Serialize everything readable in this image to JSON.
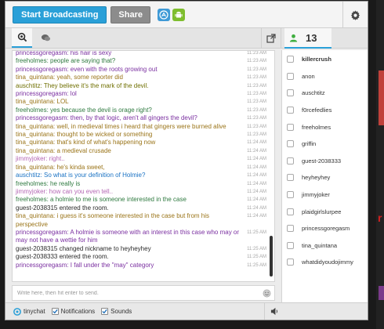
{
  "toolbar": {
    "broadcast_label": "Start Broadcasting",
    "share_label": "Share"
  },
  "tabs": {
    "user_count": "13"
  },
  "messages": [
    {
      "text": "princessgoregasm: his hair is sexy",
      "time": "11:23 AM",
      "color": "purple"
    },
    {
      "text": "freeholmes: people are saying that?",
      "time": "11:23 AM",
      "color": "green"
    },
    {
      "text": "princessgoregasm: even with the roots growing out",
      "time": "11:23 AM",
      "color": "purple"
    },
    {
      "text": "tina_quintana: yeah, some reporter did",
      "time": "11:23 AM",
      "color": "gold"
    },
    {
      "text": "auschtitz: They believe it's the mark of the devil.",
      "time": "11:23 AM",
      "color": "olive"
    },
    {
      "text": "princessgoregasm: lol",
      "time": "11:23 AM",
      "color": "purple"
    },
    {
      "text": "tina_quintana: LOL",
      "time": "11:23 AM",
      "color": "gold"
    },
    {
      "text": "freeholmes: yes because the devil is orage right?",
      "time": "11:23 AM",
      "color": "green"
    },
    {
      "text": "princessgoregasm: then, by that logic, aren't all gingers the devil?",
      "time": "11:23 AM",
      "color": "purple"
    },
    {
      "text": "tina_quintana: well, in medieval times i heard that gingers were burned alive",
      "time": "11:23 AM",
      "color": "gold"
    },
    {
      "text": "tina_quintana: thought to be wicked or something",
      "time": "11:23 AM",
      "color": "gold"
    },
    {
      "text": "tina_quintana: that's kind of what's happening now",
      "time": "11:24 AM",
      "color": "gold"
    },
    {
      "text": "tina_quintana: a medieval crusade",
      "time": "11:24 AM",
      "color": "gold"
    },
    {
      "text": "jimmyjoker: right..",
      "time": "11:24 AM",
      "color": "pink"
    },
    {
      "text": "tina_quintana: he's kinda sweet,",
      "time": "11:24 AM",
      "color": "gold"
    },
    {
      "text": "auschtitz: So what is your definition of Holmie?",
      "time": "11:24 AM",
      "color": "blue"
    },
    {
      "text": "freeholmes: he really is",
      "time": "11:24 AM",
      "color": "green"
    },
    {
      "text": "jimmyjoker: how can you even tell..",
      "time": "11:24 AM",
      "color": "pink"
    },
    {
      "text": "freeholmes: a holmie to me is someone interested in the case",
      "time": "11:24 AM",
      "color": "green"
    },
    {
      "text": "guest-2038315 entered the room.",
      "time": "11:24 AM",
      "color": "dark"
    },
    {
      "text": "tina_quintana: i guess it's someone interested in the case but from his perspective",
      "time": "11:24 AM",
      "color": "gold",
      "lines": 2
    },
    {
      "text": "princessgoregasm: A holmie is someone with an interest in this case who may or may not have a wettie for him",
      "time": "11:25 AM",
      "color": "purple",
      "lines": 2
    },
    {
      "text": "guest-2038315 changed nickname to heyheyhey",
      "time": "11:25 AM",
      "color": "dark"
    },
    {
      "text": "guest-2038333 entered the room.",
      "time": "11:25 AM",
      "color": "dark"
    },
    {
      "text": "princessgoregasm: I fall under the \"may\" category",
      "time": "11:25 AM",
      "color": "purple"
    }
  ],
  "input": {
    "placeholder": "Write here, then hit enter to send."
  },
  "bottombar": {
    "tinychat_label": "tinychat",
    "notifications_label": "Notifications",
    "sounds_label": "Sounds"
  },
  "users": [
    {
      "name": "killercrush",
      "bold": true
    },
    {
      "name": "anon"
    },
    {
      "name": "auschtitz"
    },
    {
      "name": "f0rcefedlies"
    },
    {
      "name": "freeholmes"
    },
    {
      "name": "griffin"
    },
    {
      "name": "guest-2038333"
    },
    {
      "name": "heyheyhey"
    },
    {
      "name": "jimmyjoker"
    },
    {
      "name": "plaidgirlslurpee"
    },
    {
      "name": "princessgoregasm"
    },
    {
      "name": "tina_quintana"
    },
    {
      "name": "whatdidyoudojimmy"
    }
  ],
  "colors": {
    "accent": "#2aa0d8",
    "share": "#8c8c8c",
    "android": "#7ebd2e",
    "ios": "#3f9ad6"
  },
  "icons": {
    "ios": "apple-store-icon",
    "android": "android-icon",
    "settings": "gear-icon",
    "chat_tab": "magnifier-icon",
    "private_tab": "chat-bubble-icon",
    "popout": "popout-icon",
    "users_tab": "user-icon",
    "emoji": "smiley-icon",
    "sound": "speaker-icon"
  }
}
